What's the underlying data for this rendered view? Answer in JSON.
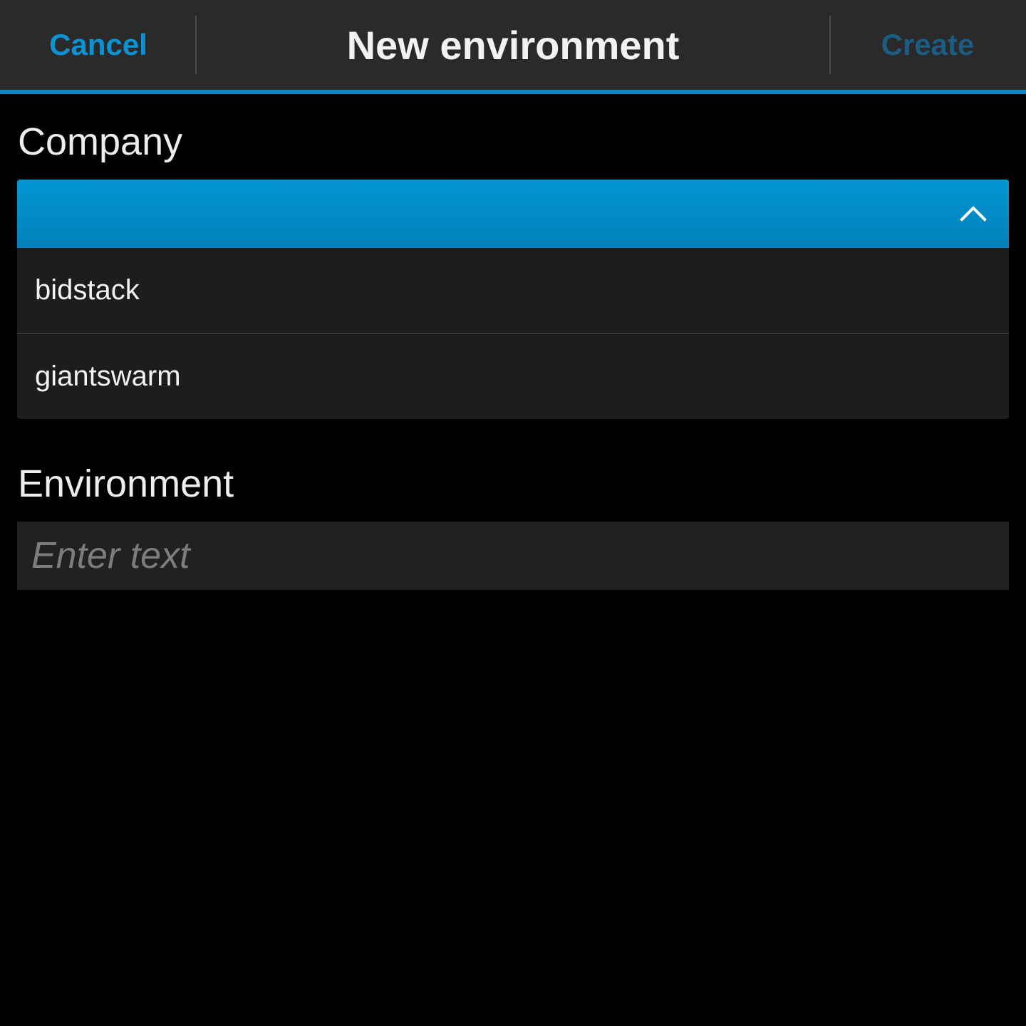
{
  "titlebar": {
    "cancel_label": "Cancel",
    "title": "New environment",
    "create_label": "Create"
  },
  "company": {
    "label": "Company",
    "selected_value": "",
    "options": [
      "bidstack",
      "giantswarm"
    ],
    "expanded": true,
    "chevron_icon": "chevron-up-icon"
  },
  "environment": {
    "label": "Environment",
    "value": "",
    "placeholder": "Enter text"
  },
  "colors": {
    "accent": "#0a86c2",
    "cancel": "#0d93d4",
    "create_disabled": "#1d5c80",
    "titlebar_bg": "#2a2a2a",
    "background": "#000000"
  }
}
